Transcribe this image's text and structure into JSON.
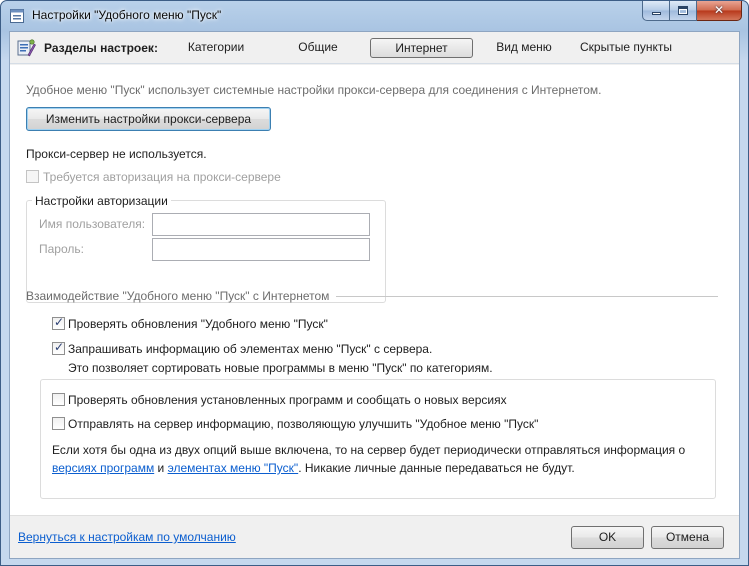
{
  "window": {
    "title": "Настройки \"Удобного меню \"Пуск\"",
    "controls": {
      "minimize": "",
      "maximize": "",
      "close": "✕"
    }
  },
  "tabs": {
    "sections_label": "Разделы настроек:",
    "items": [
      {
        "label": "Категории",
        "active": false
      },
      {
        "label": "Общие",
        "active": false
      },
      {
        "label": "Интернет",
        "active": true
      },
      {
        "label": "Вид меню",
        "active": false
      },
      {
        "label": "Скрытые пункты",
        "active": false
      }
    ]
  },
  "internet": {
    "intro": "Удобное меню \"Пуск\" использует системные настройки прокси-сервера для соединения с Интернетом.",
    "change_proxy_button": "Изменить настройки прокси-сервера",
    "proxy_status": "Прокси-сервер не используется.",
    "auth_required": {
      "label": "Требуется авторизация на прокси-сервере",
      "checked": false,
      "enabled": false
    },
    "auth_group": {
      "legend": "Настройки авторизации",
      "username_label": "Имя пользователя:",
      "username_value": "",
      "password_label": "Пароль:",
      "password_value": ""
    },
    "interaction_group": {
      "legend": "Взаимодействие \"Удобного меню \"Пуск\" с Интернетом",
      "check_updates": {
        "label": "Проверять обновления \"Удобного меню \"Пуск\"",
        "checked": true
      },
      "request_info": {
        "label": "Запрашивать информацию об элементах меню \"Пуск\" с сервера.",
        "checked": true
      },
      "request_info_note": "Это позволяет сортировать новые программы в меню \"Пуск\" по категориям.",
      "check_installed": {
        "label": "Проверять обновления установленных программ и сообщать о новых версиях",
        "checked": false
      },
      "send_info": {
        "label": "Отправлять на сервер информацию, позволяющую улучшить \"Удобное меню \"Пуск\"",
        "checked": false
      },
      "note_line1": "Если хотя бы одна из двух опций выше включена, то на сервер будет периодически отправляться информация о",
      "note_link1": "версиях программ",
      "note_and": " и ",
      "note_link2": "элементах меню \"Пуск\"",
      "note_tail": ". Никакие личные данные передаваться не будут."
    }
  },
  "footer": {
    "reset_link": "Вернуться к настройкам по умолчанию",
    "ok": "OK",
    "cancel": "Отмена"
  }
}
